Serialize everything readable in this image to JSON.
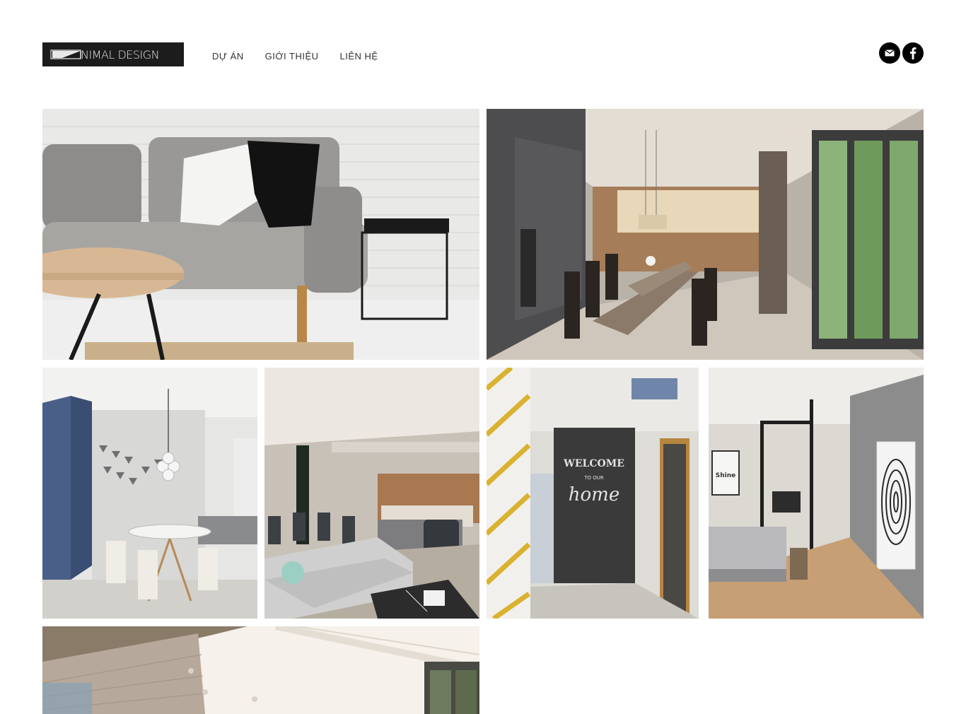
{
  "brand": {
    "logo_text": "NIMAL DESIGN"
  },
  "nav": {
    "items": [
      {
        "label": "DỰ ÁN"
      },
      {
        "label": "GIỚI THIỆU"
      },
      {
        "label": "LIÊN HỆ"
      }
    ]
  },
  "social": {
    "items": [
      {
        "icon": "mail-icon"
      },
      {
        "icon": "facebook-icon"
      }
    ]
  },
  "gallery": {
    "items": [
      {
        "subject": "living room sofa with brick wall"
      },
      {
        "subject": "dining room with long table"
      },
      {
        "subject": "dining area with round table and blue wall"
      },
      {
        "subject": "open living room and kitchen"
      },
      {
        "subject": "entrance hallway with chalkboard wall",
        "wall_text": [
          "WELCOME",
          "TO OUR",
          "home"
        ]
      },
      {
        "subject": "bedroom with fingerprint artwork",
        "poster_text": [
          "Shine"
        ]
      },
      {
        "subject": "apartment with window blinds"
      }
    ]
  },
  "colors": {
    "logo_bg": "#1c1c1c",
    "social_bg": "#000000",
    "accent_blue": "#4a5f87",
    "accent_yellow": "#d9b230"
  }
}
